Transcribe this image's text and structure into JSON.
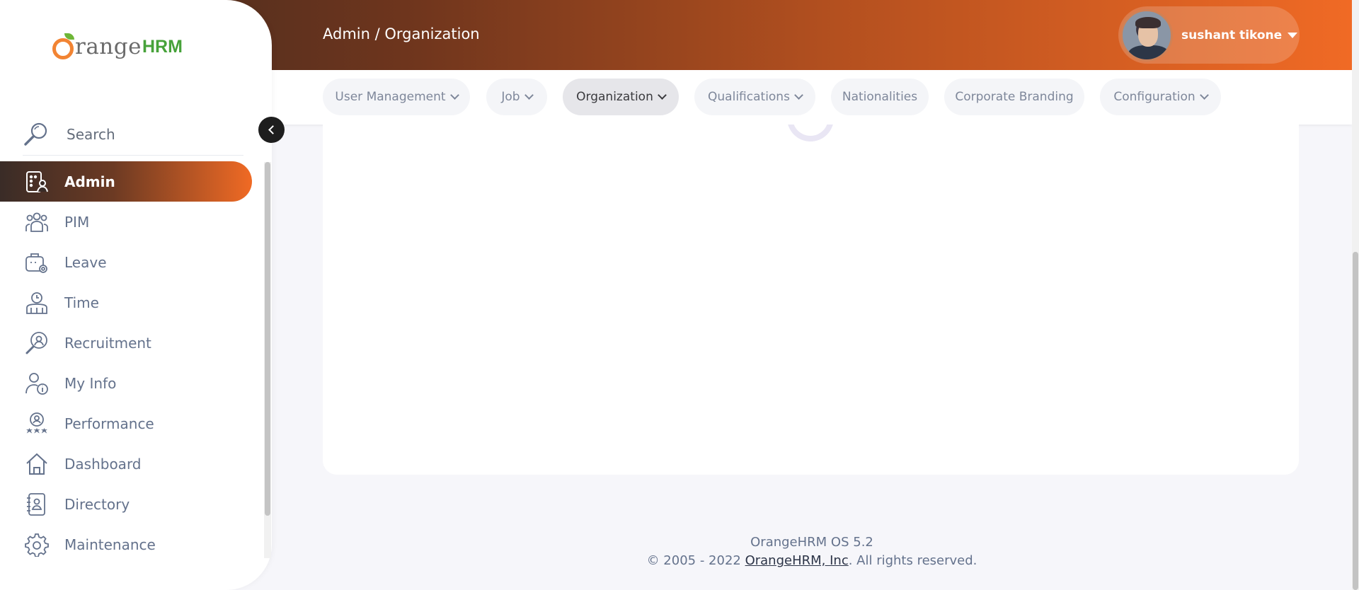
{
  "header": {
    "breadcrumb": "Admin / Organization",
    "user_name": "sushant tikone"
  },
  "topnav": {
    "items": [
      {
        "label": "User Management",
        "has_dropdown": true
      },
      {
        "label": "Job",
        "has_dropdown": true
      },
      {
        "label": "Organization",
        "has_dropdown": true,
        "active": true
      },
      {
        "label": "Qualifications",
        "has_dropdown": true
      },
      {
        "label": "Nationalities",
        "has_dropdown": false
      },
      {
        "label": "Corporate Branding",
        "has_dropdown": false
      },
      {
        "label": "Configuration",
        "has_dropdown": true
      }
    ]
  },
  "sidebar": {
    "logo_text": "range",
    "logo_hrm": "HRM",
    "search_label": "Search",
    "items": [
      {
        "label": "Admin",
        "icon": "admin-icon",
        "active": true
      },
      {
        "label": "PIM",
        "icon": "pim-icon"
      },
      {
        "label": "Leave",
        "icon": "leave-icon"
      },
      {
        "label": "Time",
        "icon": "time-icon"
      },
      {
        "label": "Recruitment",
        "icon": "recruitment-icon"
      },
      {
        "label": "My Info",
        "icon": "my-info-icon"
      },
      {
        "label": "Performance",
        "icon": "performance-icon"
      },
      {
        "label": "Dashboard",
        "icon": "dashboard-icon"
      },
      {
        "label": "Directory",
        "icon": "directory-icon"
      },
      {
        "label": "Maintenance",
        "icon": "maintenance-icon"
      }
    ]
  },
  "footer": {
    "version": "OrangeHRM OS 5.2",
    "copy_prefix": "© 2005 - 2022 ",
    "copy_link": "OrangeHRM, Inc",
    "copy_suffix": ". All rights reserved."
  },
  "colors": {
    "accent": "#f06a24",
    "header_dark": "#3d2a20",
    "text_muted": "#64728c"
  }
}
